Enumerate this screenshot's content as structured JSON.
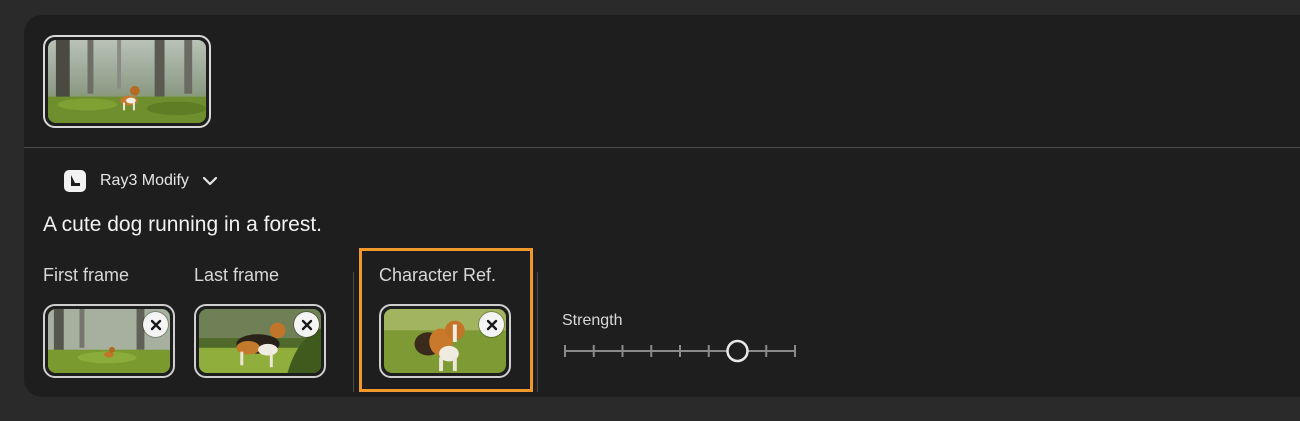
{
  "model": {
    "name": "Ray3 Modify"
  },
  "prompt": "A cute dog running in a forest.",
  "frames": {
    "first_label": "First frame",
    "last_label": "Last frame",
    "character_label": "Character Ref."
  },
  "strength": {
    "label": "Strength",
    "steps": 9,
    "value_step": 6
  },
  "icons": {
    "model": "luma-logo-icon",
    "dropdown": "chevron-down-icon",
    "remove": "close-icon"
  },
  "colors": {
    "highlight": "#f0982a",
    "panel": "#1e1e1e",
    "background": "#2a2a2a"
  }
}
